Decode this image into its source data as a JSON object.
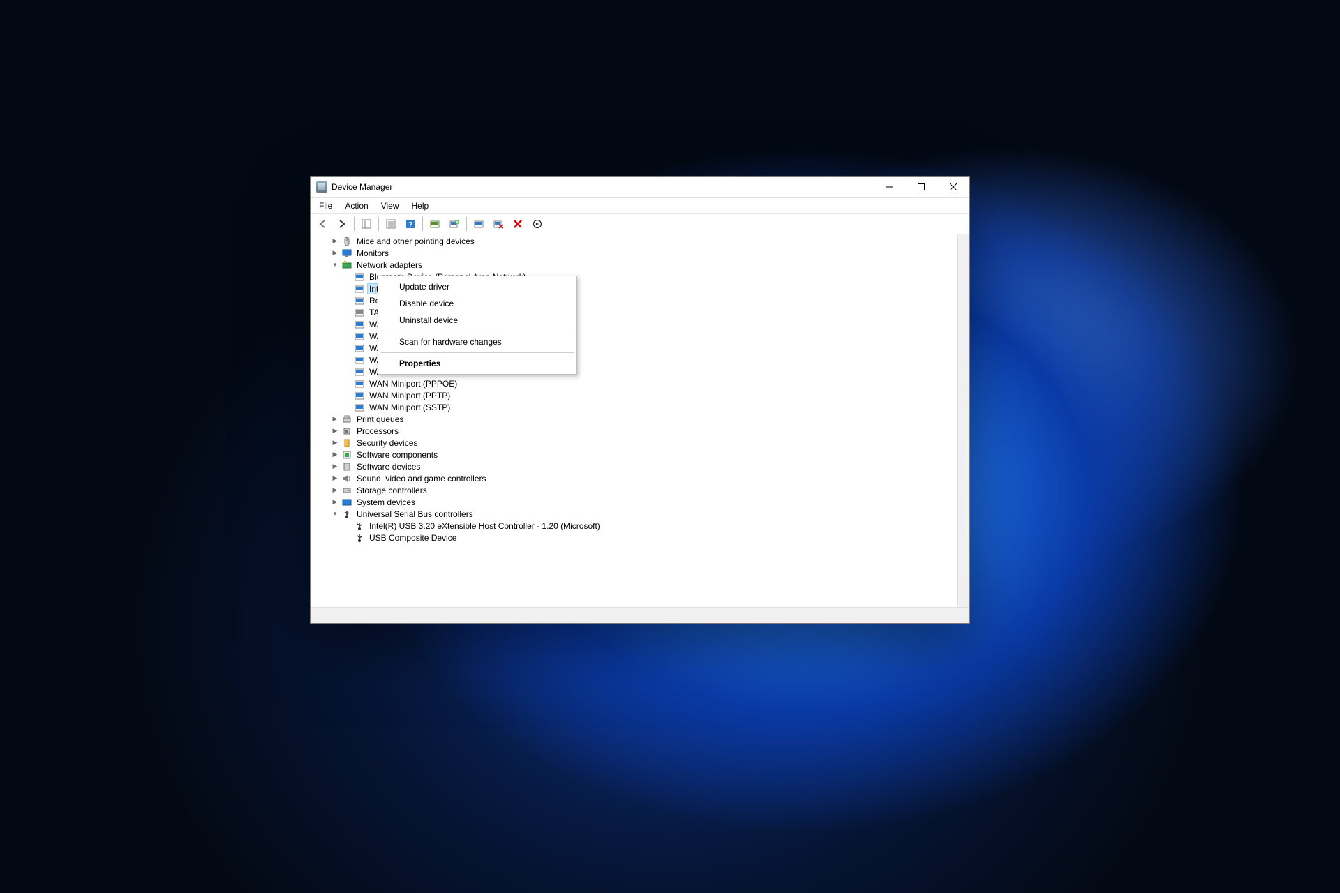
{
  "window": {
    "title": "Device Manager"
  },
  "menu": {
    "file": "File",
    "action": "Action",
    "view": "View",
    "help": "Help"
  },
  "tree": {
    "n0": "Mice and other pointing devices",
    "n1": "Monitors",
    "n2": "Network adapters",
    "n2a": "Bluetooth Device (Personal Area Network)",
    "n2b": "Inte",
    "n2c": "Rea",
    "n2d": "TAP",
    "n2e": "WA",
    "n2f": "WA",
    "n2g": "WA",
    "n2h": "WA",
    "n2i": "WA",
    "n2j": "WAN Miniport (PPPOE)",
    "n2k": "WAN Miniport (PPTP)",
    "n2l": "WAN Miniport (SSTP)",
    "n3": "Print queues",
    "n4": "Processors",
    "n5": "Security devices",
    "n6": "Software components",
    "n7": "Software devices",
    "n8": "Sound, video and game controllers",
    "n9": "Storage controllers",
    "n10": "System devices",
    "n11": "Universal Serial Bus controllers",
    "n11a": "Intel(R) USB 3.20 eXtensible Host Controller - 1.20 (Microsoft)",
    "n11b": "USB Composite Device"
  },
  "ctx": {
    "update": "Update driver",
    "disable": "Disable device",
    "uninst": "Uninstall device",
    "scan": "Scan for hardware changes",
    "props": "Properties"
  }
}
